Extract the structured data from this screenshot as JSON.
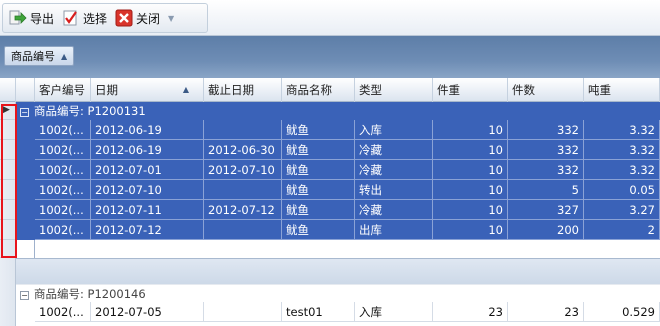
{
  "toolbar": {
    "buttons": [
      {
        "label": "导出",
        "icon": "export-arrow-icon"
      },
      {
        "label": "选择",
        "icon": "checkmark-icon"
      },
      {
        "label": "关闭",
        "icon": "close-x-icon"
      }
    ]
  },
  "group_panel": {
    "chip_label": "商品编号",
    "sort": "ascending"
  },
  "columns": [
    "客户编号",
    "日期",
    "截止日期",
    "商品名称",
    "类型",
    "件重",
    "件数",
    "吨重"
  ],
  "groups": [
    {
      "label": "商品编号: P1200131",
      "selected": true,
      "rows": [
        [
          "1002(...",
          "2012-06-19",
          "",
          "鱿鱼",
          "入库",
          "10",
          "332",
          "3.32"
        ],
        [
          "1002(...",
          "2012-06-19",
          "2012-06-30",
          "鱿鱼",
          "冷藏",
          "10",
          "332",
          "3.32"
        ],
        [
          "1002(...",
          "2012-07-01",
          "2012-07-10",
          "鱿鱼",
          "冷藏",
          "10",
          "332",
          "3.32"
        ],
        [
          "1002(...",
          "2012-07-10",
          "",
          "鱿鱼",
          "转出",
          "10",
          "5",
          "0.05"
        ],
        [
          "1002(...",
          "2012-07-11",
          "2012-07-12",
          "鱿鱼",
          "冷藏",
          "10",
          "327",
          "3.27"
        ],
        [
          "1002(...",
          "2012-07-12",
          "",
          "鱿鱼",
          "出库",
          "10",
          "200",
          "2"
        ]
      ]
    },
    {
      "label": "商品编号: P1200146",
      "selected": false,
      "rows": [
        [
          "1002(...",
          "2012-07-05",
          "",
          "test01",
          "入库",
          "23",
          "23",
          "0.529"
        ]
      ]
    }
  ],
  "colors": {
    "selection": "#3a62b8",
    "highlight_frame": "#e8141c",
    "group_panel": "#6e8db5"
  }
}
